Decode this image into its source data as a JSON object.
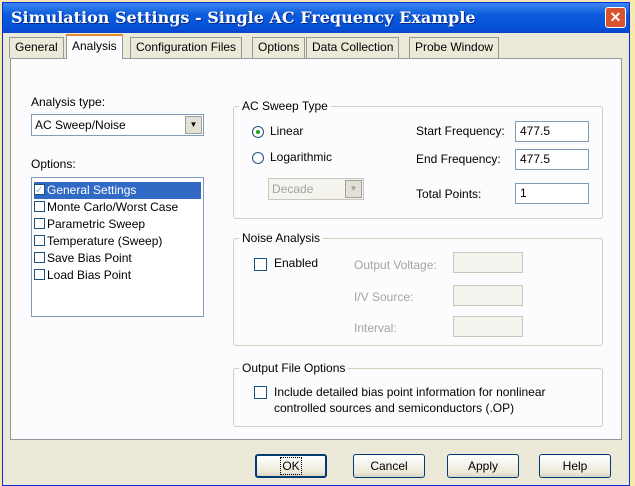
{
  "window": {
    "title": "Simulation Settings - Single AC Frequency Example",
    "close_glyph": "✕"
  },
  "tabs": [
    {
      "label": "General"
    },
    {
      "label": "Analysis"
    },
    {
      "label": "Configuration Files"
    },
    {
      "label": "Options"
    },
    {
      "label": "Data Collection"
    },
    {
      "label": "Probe Window"
    }
  ],
  "analysis_type": {
    "label": "Analysis type:",
    "value": "AC Sweep/Noise"
  },
  "options": {
    "label": "Options:",
    "items": [
      {
        "label": "General Settings",
        "checked": true,
        "selected": true
      },
      {
        "label": "Monte Carlo/Worst Case",
        "checked": false
      },
      {
        "label": "Parametric Sweep",
        "checked": false
      },
      {
        "label": "Temperature (Sweep)",
        "checked": false
      },
      {
        "label": "Save Bias Point",
        "checked": false
      },
      {
        "label": "Load Bias Point",
        "checked": false
      }
    ]
  },
  "ac_sweep": {
    "title": "AC Sweep Type",
    "linear": "Linear",
    "logarithmic": "Logarithmic",
    "selected": "Linear",
    "log_scale": "Decade",
    "start_label": "Start Frequency:",
    "start_value": "477.5",
    "end_label": "End Frequency:",
    "end_value": "477.5",
    "points_label": "Total Points:",
    "points_value": "1"
  },
  "noise": {
    "title": "Noise Analysis",
    "enabled_label": "Enabled",
    "enabled": false,
    "output_voltage_label": "Output Voltage:",
    "iv_source_label": "I/V Source:",
    "interval_label": "Interval:"
  },
  "output_file": {
    "title": "Output File Options",
    "line1": "Include detailed bias point information for nonlinear",
    "line2": "controlled sources and semiconductors (.OP)",
    "checked": false
  },
  "buttons": {
    "ok": "OK",
    "cancel": "Cancel",
    "apply": "Apply",
    "help": "Help"
  },
  "colors": {
    "titlebar": "#0550d8",
    "selection": "#316ac5",
    "active_tab_accent": "#e68b2c",
    "dialog_bg": "#ece9d8",
    "close": "#d9532c"
  }
}
